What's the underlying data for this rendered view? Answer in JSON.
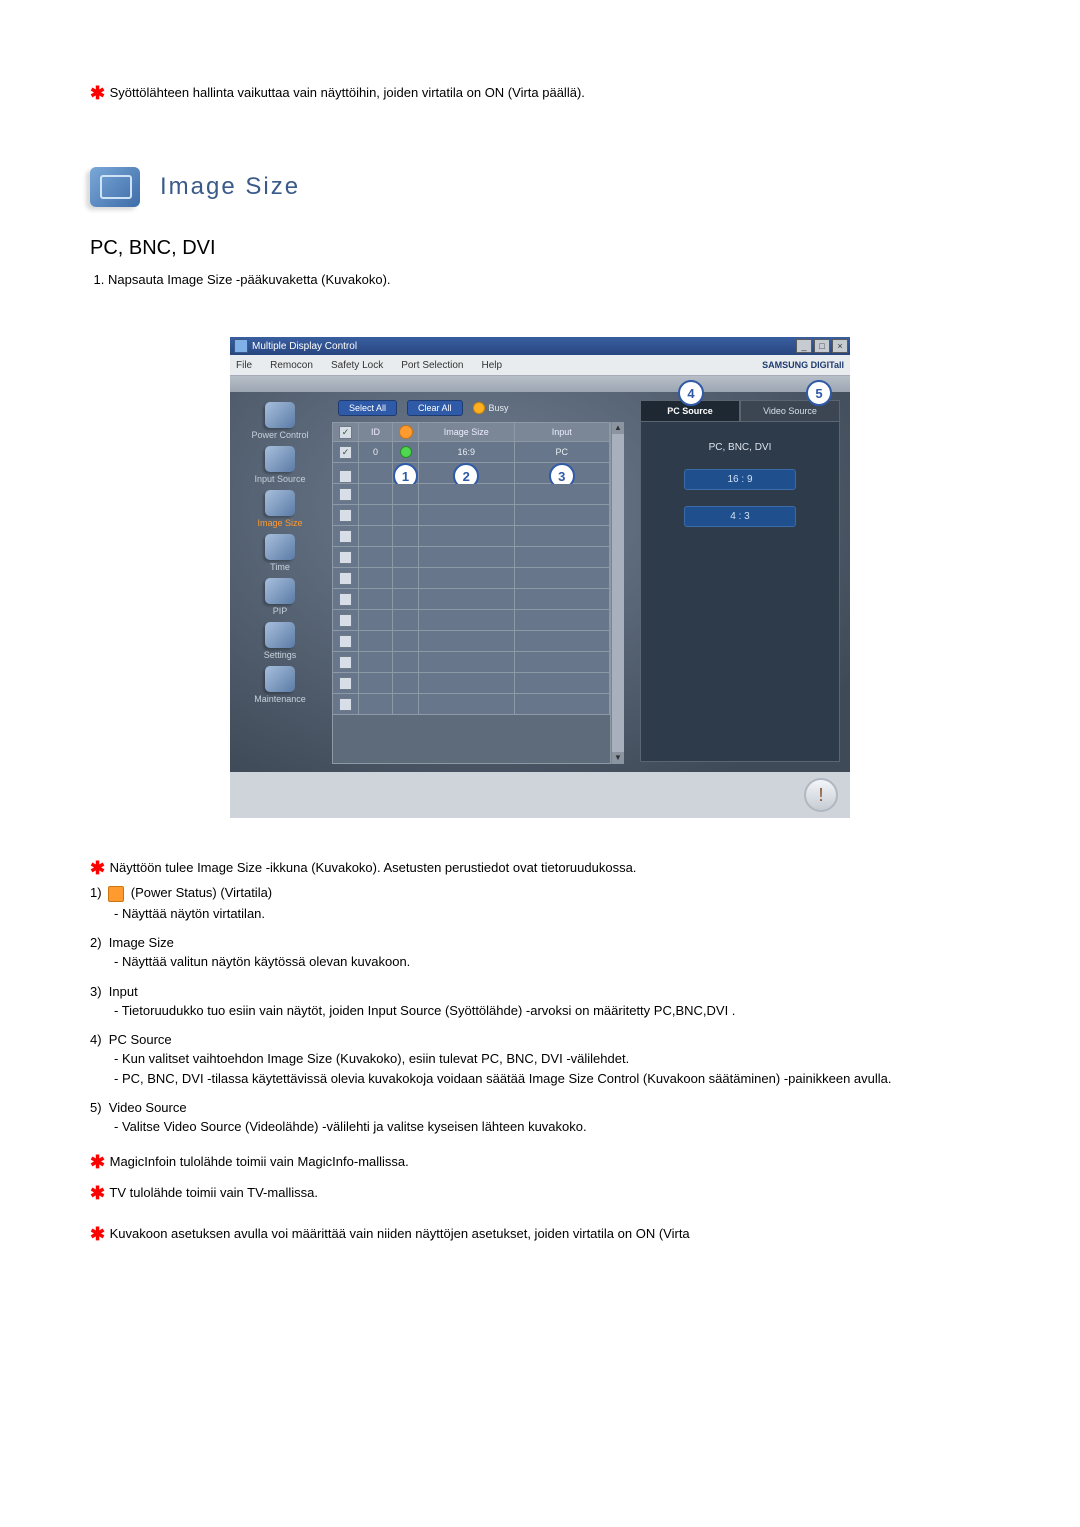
{
  "top_note": "Syöttölähteen hallinta vaikuttaa vain näyttöihin, joiden virtatila on ON (Virta päällä).",
  "section_title": "Image Size",
  "subheading": "PC, BNC, DVI",
  "step1": "Napsauta Image Size -pääkuvaketta (Kuvakoko).",
  "app": {
    "title": "Multiple Display Control",
    "menu": {
      "file": "File",
      "remocon": "Remocon",
      "safety": "Safety Lock",
      "port": "Port Selection",
      "help": "Help"
    },
    "brand": "SAMSUNG DIGITall",
    "select_all": "Select All",
    "clear_all": "Clear All",
    "busy": "Busy",
    "sidebar": {
      "power": "Power Control",
      "input": "Input Source",
      "image": "Image Size",
      "time": "Time",
      "pip": "PIP",
      "settings": "Settings",
      "maint": "Maintenance"
    },
    "grid": {
      "h_id": "ID",
      "h_imgsize": "Image Size",
      "h_input": "Input",
      "row0": {
        "id": "0",
        "size": "16:9",
        "input": "PC"
      }
    },
    "tabs": {
      "pc": "PC Source",
      "video": "Video Source"
    },
    "panel_header": "PC, BNC, DVI",
    "opt_169": "16 : 9",
    "opt_43": "4 : 3",
    "callouts": {
      "c1": "1",
      "c2": "2",
      "c3": "3",
      "c4": "4",
      "c5": "5"
    }
  },
  "below": {
    "intro": "Näyttöön tulee Image Size -ikkuna (Kuvakoko). Asetusten perustiedot ovat tietoruudukossa.",
    "i1_hdr": "1)    (Power Status) (Virtatila)",
    "i1_body": "- Näyttää näytön virtatilan.",
    "i2_hdr": "2)  Image Size",
    "i2_body": "- Näyttää valitun näytön käytössä olevan kuvakoon.",
    "i3_hdr": "3)  Input",
    "i3_body": "- Tietoruudukko tuo esiin vain näytöt, joiden Input Source (Syöttölähde) -arvoksi on määritetty PC,BNC,DVI .",
    "i4_hdr": "4)  PC Source",
    "i4_body1": "- Kun valitset vaihtoehdon Image Size (Kuvakoko), esiin tulevat PC, BNC, DVI -välilehdet.",
    "i4_body2": "- PC, BNC, DVI -tilassa käytettävissä olevia kuvakokoja voidaan säätää Image Size Control (Kuvakoon säätäminen) -painikkeen avulla.",
    "i5_hdr": "5)  Video Source",
    "i5_body": "- Valitse Video Source (Videolähde) -välilehti ja valitse kyseisen lähteen kuvakoko.",
    "n_magic": "MagicInfoin tulolähde toimii vain MagicInfo-mallissa.",
    "n_tv": "TV tulolähde toimii vain TV-mallissa.",
    "n_last": "Kuvakoon asetuksen avulla voi määrittää vain niiden näyttöjen asetukset, joiden virtatila on ON (Virta"
  }
}
